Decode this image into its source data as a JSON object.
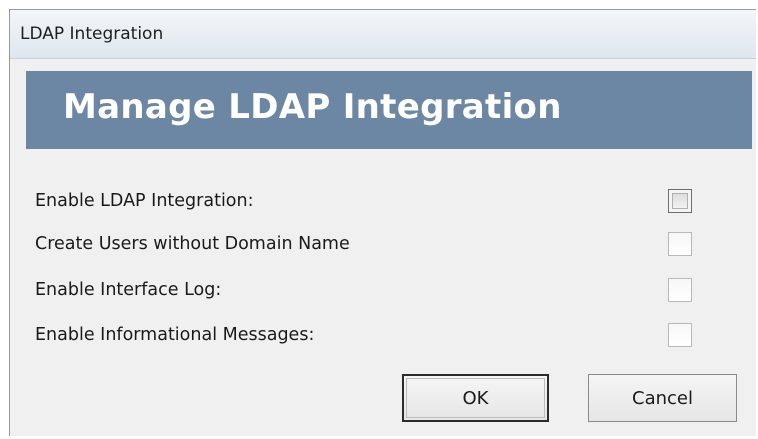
{
  "window": {
    "title": "LDAP Integration"
  },
  "banner": {
    "title": "Manage LDAP Integration",
    "color": "#6b87a3"
  },
  "options": [
    {
      "label": "Enable LDAP Integration:",
      "checked": false
    },
    {
      "label": "Create Users without Domain Name",
      "checked": false
    },
    {
      "label": "Enable Interface Log:",
      "checked": false
    },
    {
      "label": "Enable Informational Messages:",
      "checked": false
    }
  ],
  "buttons": {
    "ok_label": "OK",
    "cancel_label": "Cancel"
  }
}
